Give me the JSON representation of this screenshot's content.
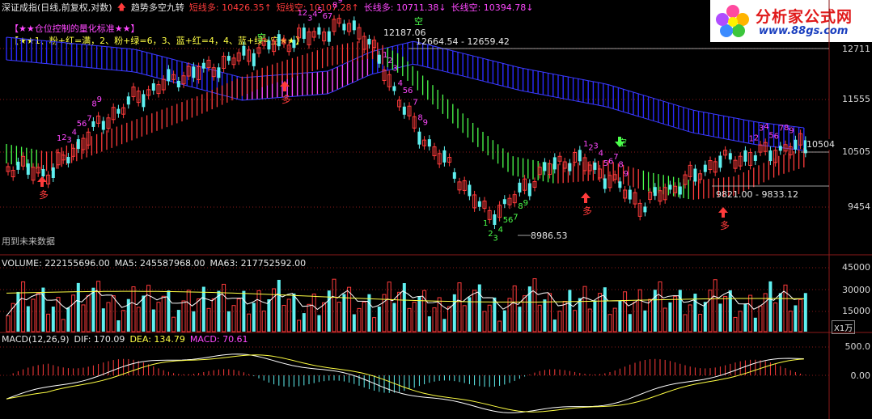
{
  "header": {
    "chart_name": "深证成指(日线,前复权,对数)",
    "indicator_name": "趋势多空九转",
    "values": [
      {
        "label": "短线多: 10426.35",
        "arrow": "up",
        "color": "#ff3b3b"
      },
      {
        "label": "短线空: 10107.28",
        "arrow": "up",
        "color": "#ff3b3b"
      },
      {
        "label": "长线多: 10711.38",
        "arrow": "down",
        "color": "#ff48ff"
      },
      {
        "label": "长线空: 10394.78",
        "arrow": "down",
        "color": "#ff48ff"
      }
    ]
  },
  "legend": {
    "title": "【★★仓位控制的量化标准★★】",
    "rules": "【★★1、粉+红=满，2、粉+绿=6，3、蓝+红=4，4、蓝+绿=空★★】"
  },
  "logo": {
    "brand": "分析家公式网",
    "url": "www.88gs.com"
  },
  "price_panel": {
    "yticks": [
      "12711",
      "11555",
      "10505",
      "9454"
    ],
    "annotations": {
      "high": "12187.06",
      "high_range": "12664.54 - 12659.42",
      "low": "8986.53",
      "mid_range": "9821.00 - 9833.12",
      "last": "10504",
      "future_note": "用到未来数据"
    },
    "signals": {
      "duo": "多",
      "kong": "空"
    },
    "count_labels": [
      "1",
      "2",
      "3",
      "4",
      "5",
      "6",
      "7",
      "8",
      "9"
    ]
  },
  "volume_panel": {
    "title": "VOLUME: 222155696.00",
    "ma5": "MA5: 245587968.00",
    "ma63": "MA63: 217752592.00",
    "yticks": [
      "45000",
      "30000",
      "15000"
    ],
    "unit": "X1万"
  },
  "macd_panel": {
    "title": "MACD(12,26,9)",
    "dif": "DIF: 170.09",
    "dea": "DEA: 134.79",
    "macd": "MACD: 70.61",
    "yticks": [
      "500.0",
      "0.00"
    ]
  },
  "colors": {
    "up": "#ff3b3b",
    "down": "#5ff0f0",
    "ribbon_long_bull": "#ff48ff",
    "ribbon_long_bear": "#2a2aff",
    "ribbon_short_bull": "#ff3b3b",
    "ribbon_short_bear": "#4cff4c",
    "grid": "#8b1a1a"
  }
}
